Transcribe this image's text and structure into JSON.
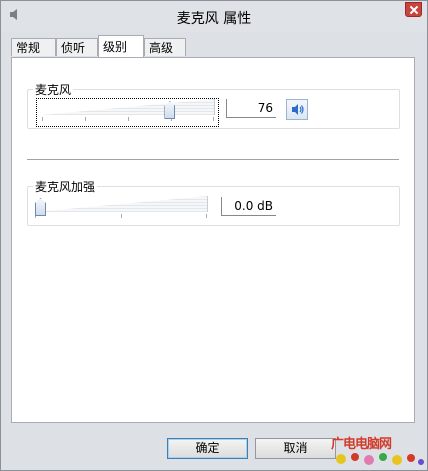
{
  "window": {
    "title": "麦克风 属性"
  },
  "tabs": [
    {
      "label": "常规",
      "active": false
    },
    {
      "label": "侦听",
      "active": false
    },
    {
      "label": "级别",
      "active": true
    },
    {
      "label": "高级",
      "active": false
    }
  ],
  "microphone": {
    "group_label": "麦克风",
    "level_value": "76",
    "level_fraction": 0.76,
    "speaker_icon": "speaker-icon"
  },
  "boost": {
    "group_label": "麦克风加强",
    "value": "0.0 dB",
    "level_fraction": 0.0
  },
  "buttons": {
    "ok": "确定",
    "cancel": "取消"
  },
  "watermark": {
    "text": "广电电脑网"
  },
  "colors": {
    "titlebar": "#dfe3e8",
    "close_button": "#c7453e",
    "speaker_blue": "#2a6cc7"
  }
}
